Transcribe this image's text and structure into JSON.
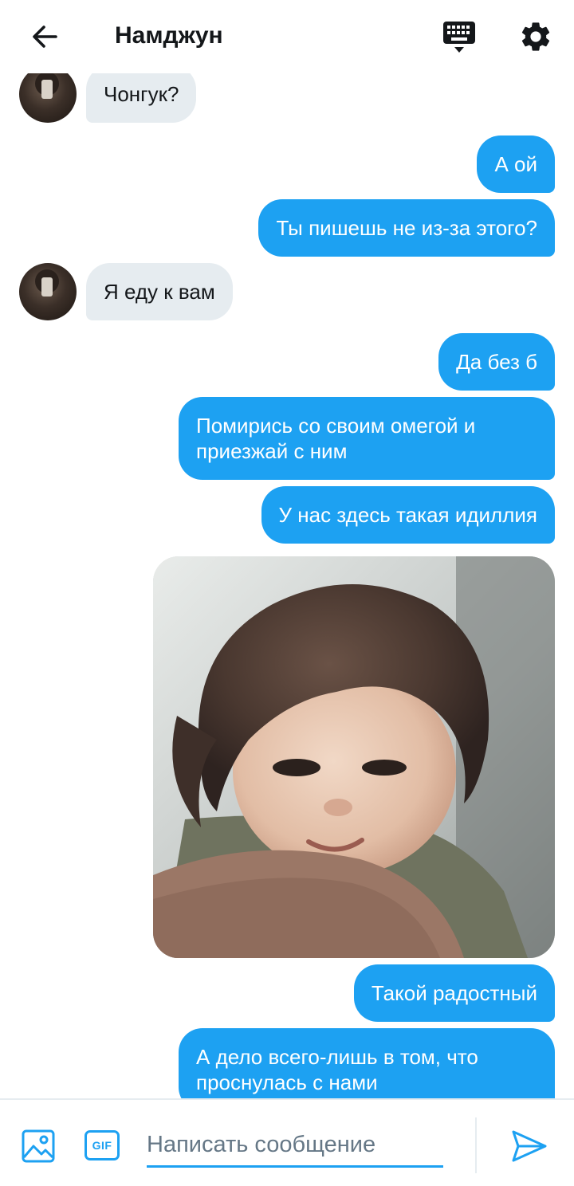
{
  "header": {
    "title": "Намджун"
  },
  "messages": [
    {
      "id": "m1",
      "direction": "incoming",
      "text": "Чонгук?"
    },
    {
      "id": "m2",
      "direction": "outgoing",
      "text": "А ой"
    },
    {
      "id": "m3",
      "direction": "outgoing",
      "text": "Ты пишешь не из-за этого?"
    },
    {
      "id": "m4",
      "direction": "incoming",
      "text": "Я еду к вам"
    },
    {
      "id": "m5",
      "direction": "outgoing",
      "text": "Да без б"
    },
    {
      "id": "m6",
      "direction": "outgoing",
      "text": "Помирись со своим омегой и приезжай с ним"
    },
    {
      "id": "m7",
      "direction": "outgoing",
      "text": "У нас здесь такая идиллия"
    },
    {
      "id": "m8",
      "direction": "outgoing",
      "type": "image"
    },
    {
      "id": "m9",
      "direction": "outgoing",
      "text": "Такой радостный"
    },
    {
      "id": "m10",
      "direction": "outgoing",
      "text": "А дело всего-лишь в том, что проснулась с нами"
    }
  ],
  "composer": {
    "placeholder": "Написать сообщение",
    "gif_label": "GIF"
  },
  "colors": {
    "accent": "#1da1f2",
    "incoming_bubble": "#e6ecf0",
    "text": "#14171a",
    "placeholder": "#657786"
  },
  "icons": {
    "back": "arrow-left-icon",
    "keyboard": "keyboard-icon",
    "settings": "gear-icon",
    "image": "image-icon",
    "gif": "gif-icon",
    "send": "send-icon"
  }
}
